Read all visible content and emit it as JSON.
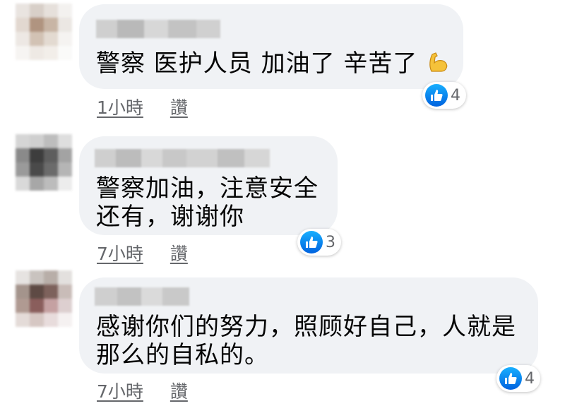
{
  "colors": {
    "bubble": "#f0f2f5",
    "text": "#050505",
    "meta": "#65676b",
    "like": "#1877f2"
  },
  "comments": [
    {
      "text": "警察 医护人员 加油了 辛苦了",
      "emoji": "flexed-biceps-icon",
      "time": "1小時",
      "action": "讚",
      "reactions": "4"
    },
    {
      "text": "警察加油，注意安全\n还有，谢谢你",
      "time": "7小時",
      "action": "讚",
      "reactions": "3"
    },
    {
      "text": "感谢你们的努力，照顾好自己，人就是\n那么的自私的。",
      "time": "7小時",
      "action": "讚",
      "reactions": "4"
    }
  ]
}
